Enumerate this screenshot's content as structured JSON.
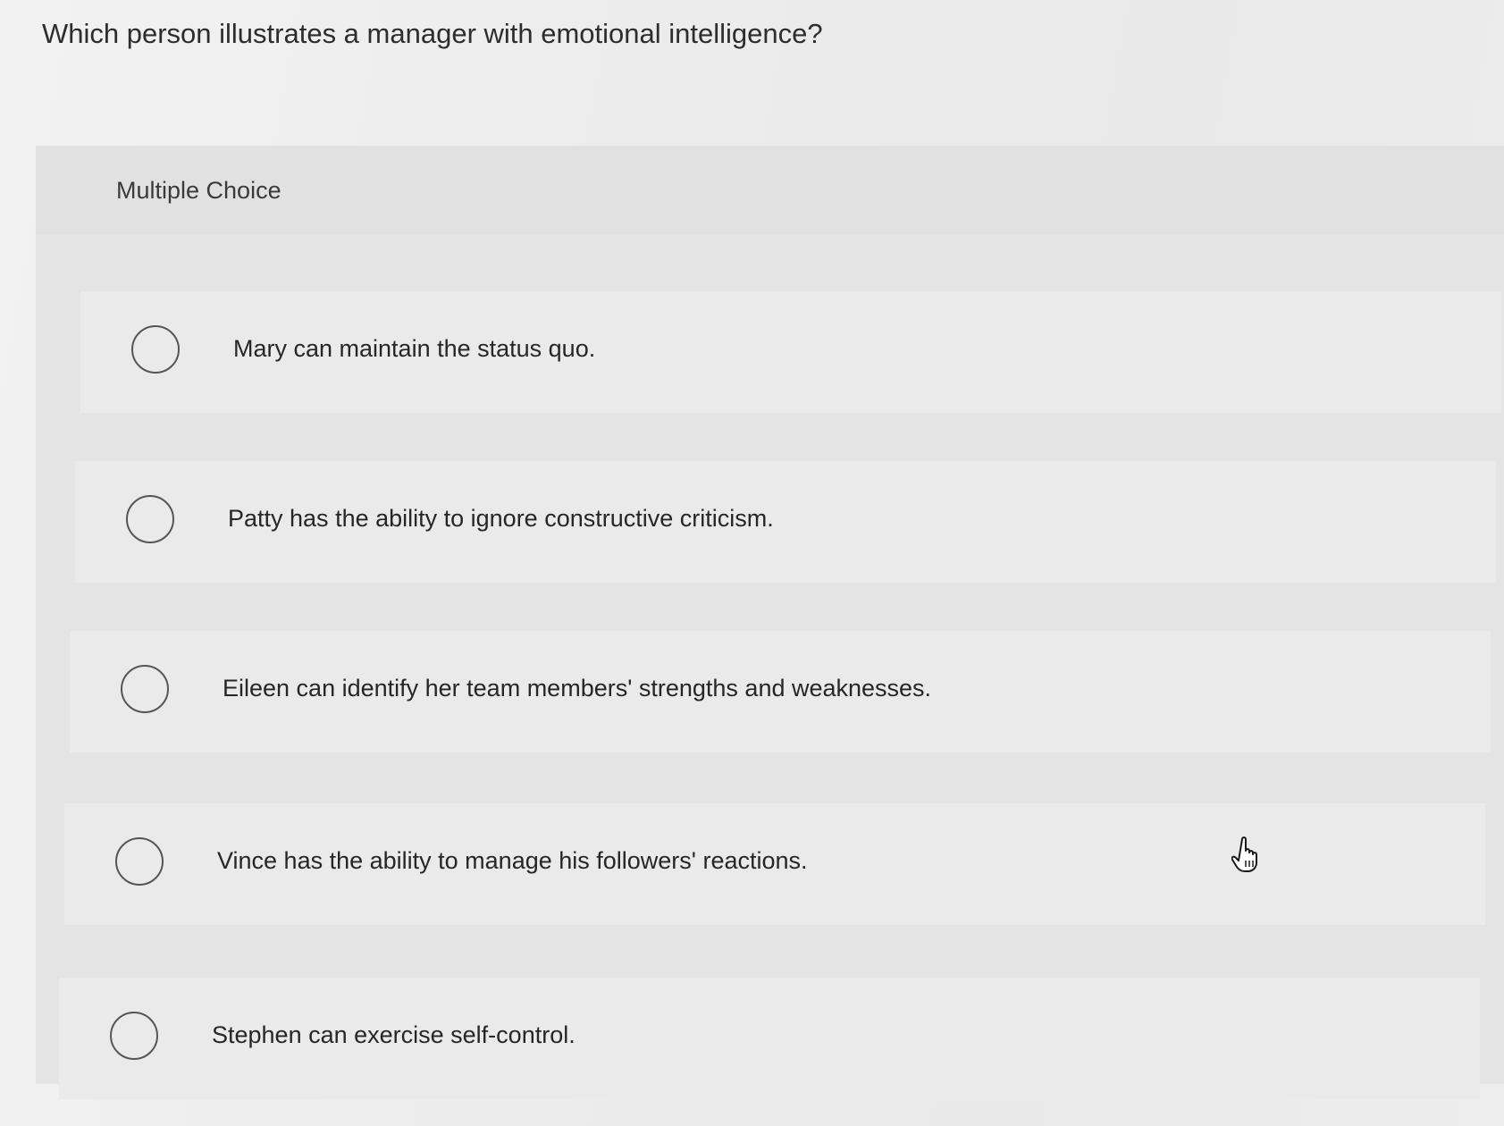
{
  "question": {
    "text": "Which person illustrates a manager with emotional intelligence?"
  },
  "panel": {
    "type_label": "Multiple Choice"
  },
  "options": [
    {
      "label": "Mary can maintain the status quo.",
      "selected": false
    },
    {
      "label": "Patty has the ability to ignore constructive criticism.",
      "selected": false
    },
    {
      "label": "Eileen can identify her team members' strengths and weaknesses.",
      "selected": false
    },
    {
      "label": "Vince has the ability to manage his followers' reactions.",
      "selected": false
    },
    {
      "label": "Stephen can exercise self-control.",
      "selected": false
    }
  ],
  "cursor": {
    "icon": "hand-pointer-icon"
  }
}
